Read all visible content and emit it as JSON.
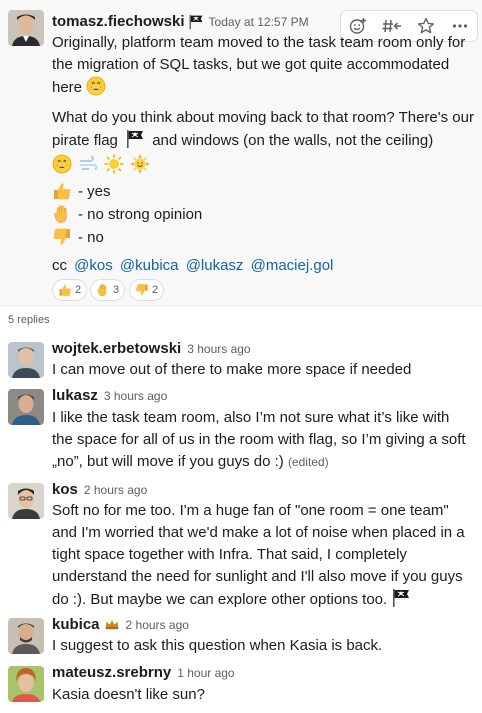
{
  "parent": {
    "username": "tomasz.fiechowski",
    "timestamp": "Today at 12:57 PM",
    "para1": "Originally, platform team moved to the task team room only for the migration of SQL tasks, but we got quite accommodated here",
    "para2a": "What do you think about moving back to that room? There's our pirate flag",
    "para2b": "and windows (on the walls, not the ceiling)",
    "votes": [
      {
        "icon": "thumbs-up",
        "label": "- yes"
      },
      {
        "icon": "raised-hand",
        "label": "- no strong opinion"
      },
      {
        "icon": "thumbs-down",
        "label": "- no"
      }
    ],
    "cc_label": "cc",
    "mentions": [
      "@kos",
      "@kubica",
      "@lukasz",
      "@maciej.gol"
    ],
    "reactions": [
      {
        "icon": "thumbs-up",
        "count": "2"
      },
      {
        "icon": "raised-hand",
        "count": "3"
      },
      {
        "icon": "thumbs-down",
        "count": "2"
      }
    ]
  },
  "replies_count": "5 replies",
  "replies": [
    {
      "username": "wojtek.erbetowski",
      "timestamp": "3 hours ago",
      "lines": [
        "I can move out of there to make more space if needed"
      ]
    },
    {
      "username": "lukasz",
      "timestamp": "3 hours ago",
      "lines": [
        "I like the task team room, also I’m not sure what it’s like with",
        "the space for all of us in the room with flag, so I’m giving a soft",
        "„no”, but will move if you guys do :)"
      ],
      "edited": "(edited)"
    },
    {
      "username": "kos",
      "timestamp": "2 hours ago",
      "lines": [
        "Soft no for me too. I'm a huge fan of \"one room = one team\"",
        "and I'm worried that we'd make a lot of noise when placed in a",
        "tight space together with Infra. That said, I completely",
        "understand the need for sunlight and I'll also move if you guys",
        "do :). But maybe we can explore other options too."
      ]
    },
    {
      "username": "kubica",
      "timestamp": "2 hours ago",
      "lines": [
        "I suggest to ask this question when Kasia is back."
      ]
    },
    {
      "username": "mateusz.srebrny",
      "timestamp": "1 hour ago",
      "lines": [
        "Kasia doesn't like sun?"
      ]
    }
  ],
  "colors": {
    "mention": "#1264a3",
    "parent_bg": "#f8f8f8",
    "muted": "#616061"
  }
}
